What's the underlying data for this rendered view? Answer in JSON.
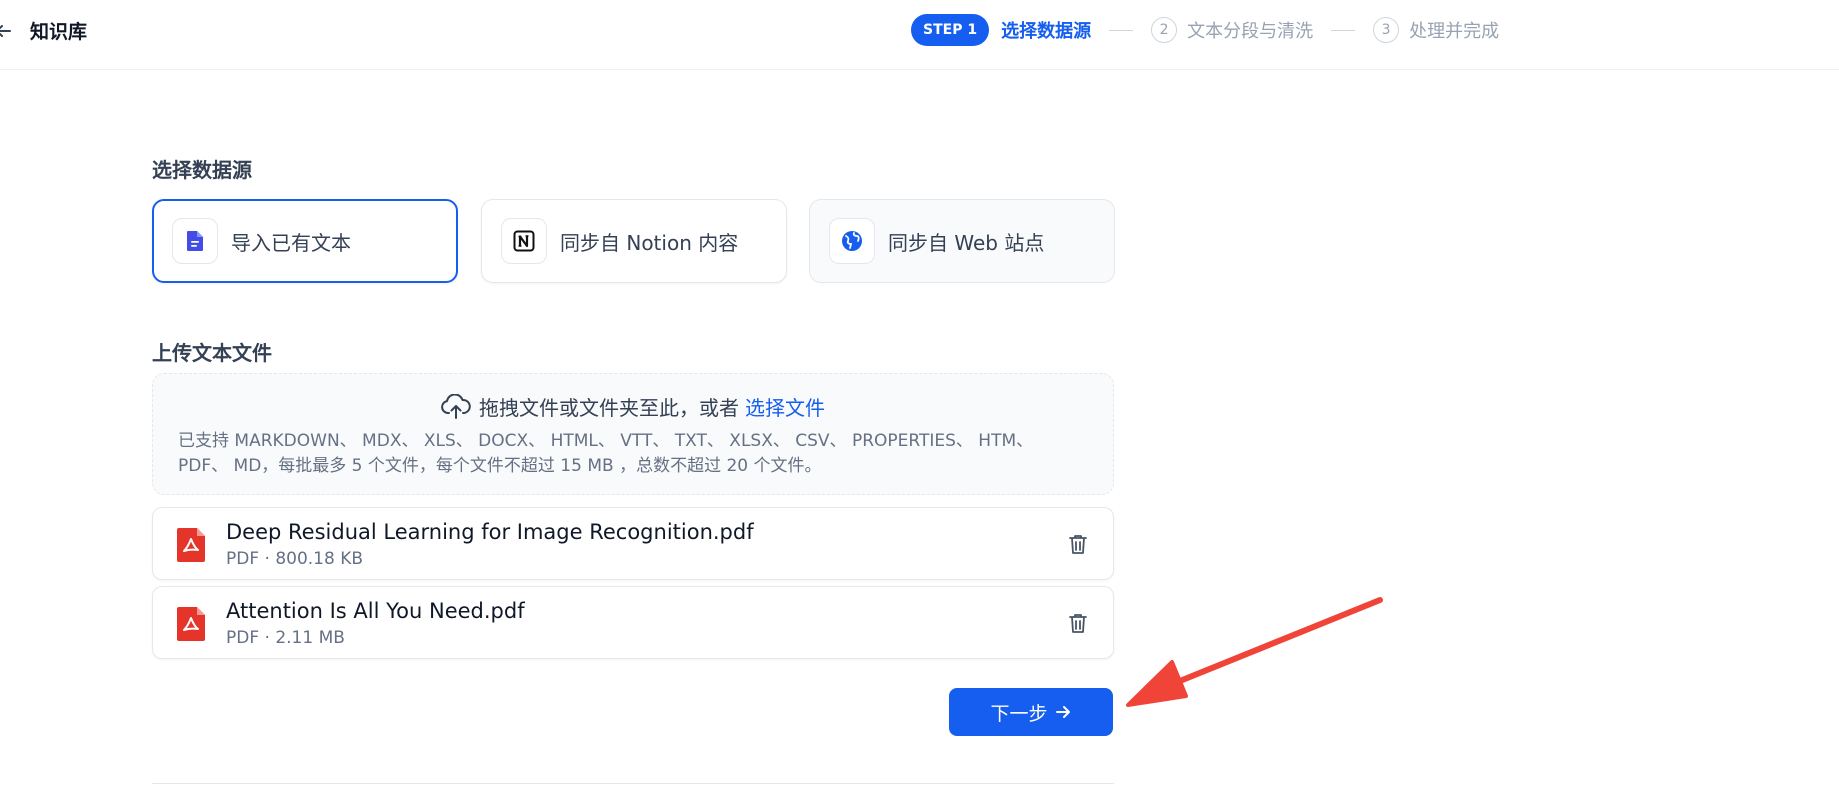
{
  "header": {
    "title": "知识库",
    "steps": [
      {
        "badge": "STEP 1",
        "label": "选择数据源",
        "state": "active"
      },
      {
        "number": "2",
        "label": "文本分段与清洗",
        "state": "inactive"
      },
      {
        "number": "3",
        "label": "处理并完成",
        "state": "inactive"
      }
    ]
  },
  "data_source": {
    "title": "选择数据源",
    "options": [
      {
        "label": "导入已有文本",
        "icon": "document-icon"
      },
      {
        "label": "同步自 Notion 内容",
        "icon": "notion-icon"
      },
      {
        "label": "同步自 Web 站点",
        "icon": "globe-icon"
      }
    ]
  },
  "upload": {
    "title": "上传文本文件",
    "drop_text": "拖拽文件或文件夹至此，或者",
    "select_link": "选择文件",
    "supported_text": "已支持 MARKDOWN、 MDX、 XLS、 DOCX、 HTML、 VTT、 TXT、 XLSX、 CSV、 PROPERTIES、 HTM、 PDF、 MD，每批最多 5 个文件，每个文件不超过 15 MB ，总数不超过 20 个文件。"
  },
  "files": [
    {
      "name": "Deep Residual Learning for Image Recognition.pdf",
      "meta": "PDF · 800.18 KB"
    },
    {
      "name": "Attention Is All You Need.pdf",
      "meta": "PDF · 2.11 MB"
    }
  ],
  "actions": {
    "next_label": "下一步"
  },
  "colors": {
    "primary": "#155eef",
    "annotation_arrow": "#f04438",
    "pdf_icon": "#e5352a"
  }
}
